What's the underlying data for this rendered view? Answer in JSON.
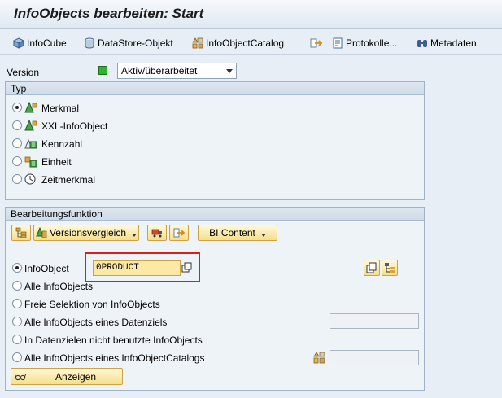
{
  "title": "InfoObjects bearbeiten: Start",
  "toolbar": {
    "infocube": "InfoCube",
    "datastore": "DataStore-Objekt",
    "catalog": "InfoObjectCatalog",
    "protokolle": "Protokolle...",
    "metadaten": "Metadaten"
  },
  "version": {
    "label": "Version",
    "status_color": "#2bb52b",
    "value": "Aktiv/überarbeitet"
  },
  "typ": {
    "title": "Typ",
    "options": [
      "Merkmal",
      "XXL-InfoObject",
      "Kennzahl",
      "Einheit",
      "Zeitmerkmal"
    ],
    "selected": "Merkmal"
  },
  "bearbeitung": {
    "title": "Bearbeitungsfunktion",
    "versionsvergleich": "Versionsvergleich",
    "bi_content": "BI Content",
    "options": [
      "InfoObject",
      "Alle InfoObjects",
      "Freie Selektion von InfoObjects",
      "Alle InfoObjects eines Datenziels",
      "In Datenzielen nicht benutzte InfoObjects",
      "Alle InfoObjects eines InfoObjectCatalogs"
    ],
    "selected": "InfoObject",
    "infoobject_value": "0PRODUCT",
    "highlight_color": "#e01b1b",
    "anzeigen": "Anzeigen"
  }
}
